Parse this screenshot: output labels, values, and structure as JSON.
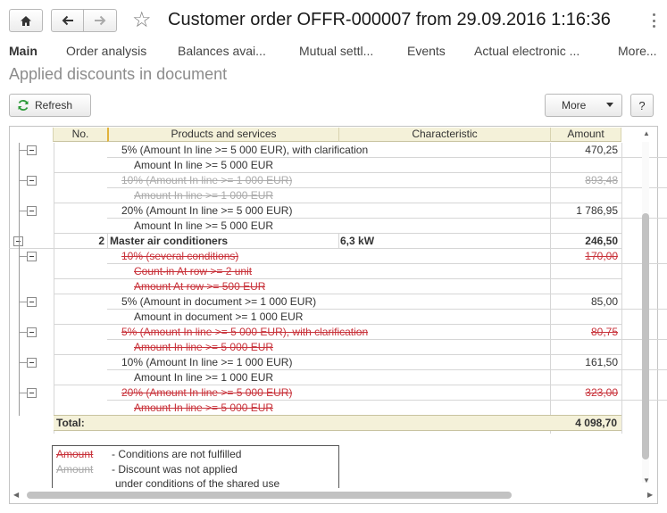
{
  "window": {
    "title": "Customer order OFFR-000007 from 29.09.2016 1:16:36",
    "home_icon": "home-icon",
    "back_icon": "arrow-left-icon",
    "forward_icon": "arrow-right-icon",
    "favorite_icon": "star-icon",
    "menu_icon": "kebab-icon"
  },
  "tabs": [
    "Main",
    "Order analysis",
    "Balances avai...",
    "Mutual settl...",
    "Events",
    "Actual electronic ...",
    "More..."
  ],
  "section_title": "Applied discounts in document",
  "toolbar": {
    "refresh_label": "Refresh",
    "more_label": "More",
    "help_label": "?"
  },
  "table": {
    "columns": [
      "No.",
      "Products and services",
      "Characteristic",
      "Amount"
    ],
    "rows": [
      {
        "text": "5% (Amount In line >= 5 000 EUR), with clarification",
        "amount": "470,25",
        "style": "normal",
        "toggle": true
      },
      {
        "text": "Amount In line >= 5 000 EUR",
        "amount": "",
        "style": "normal",
        "toggle": false
      },
      {
        "text": "10% (Amount In line >= 1 000 EUR)",
        "amount": "893,48",
        "style": "gray",
        "toggle": true
      },
      {
        "text": "Amount In line >= 1 000 EUR",
        "amount": "",
        "style": "gray",
        "toggle": false
      },
      {
        "text": "20% (Amount In line >= 5 000 EUR)",
        "amount": "1 786,95",
        "style": "normal",
        "toggle": true
      },
      {
        "text": "Amount In line >= 5 000 EUR",
        "amount": "",
        "style": "normal",
        "toggle": false
      },
      {
        "no": "2",
        "text": "Master air conditioners",
        "characteristic": "6,3 kW",
        "amount": "246,50",
        "style": "bold",
        "toggle": true
      },
      {
        "text": "10% (several conditions)",
        "amount": "170,00",
        "style": "red",
        "toggle": true
      },
      {
        "text": "Count-in At row >= 2 unit",
        "amount": "",
        "style": "red",
        "toggle": false
      },
      {
        "text": "Amount At row >= 500 EUR",
        "amount": "",
        "style": "red",
        "toggle": false
      },
      {
        "text": "5% (Amount in document >= 1 000 EUR)",
        "amount": "85,00",
        "style": "normal",
        "toggle": true
      },
      {
        "text": "Amount in document >= 1 000 EUR",
        "amount": "",
        "style": "normal",
        "toggle": false
      },
      {
        "text": "5% (Amount In line >= 5 000 EUR), with clarification",
        "amount": "80,75",
        "style": "red",
        "toggle": true
      },
      {
        "text": "Amount In line >= 5 000 EUR",
        "amount": "",
        "style": "red",
        "toggle": false
      },
      {
        "text": "10% (Amount In line >= 1 000 EUR)",
        "amount": "161,50",
        "style": "normal",
        "toggle": true
      },
      {
        "text": "Amount In line >= 1 000 EUR",
        "amount": "",
        "style": "normal",
        "toggle": false
      },
      {
        "text": "20% (Amount In line >= 5 000 EUR)",
        "amount": "323,00",
        "style": "red",
        "toggle": true
      },
      {
        "text": "Amount In line >= 5 000 EUR",
        "amount": "",
        "style": "red",
        "toggle": false
      }
    ],
    "total_label": "Total:",
    "total_amount": "4 098,70"
  },
  "legend": {
    "red_sample": "Amount",
    "red_text": "- Conditions are not fulfilled",
    "gray_sample": "Amount",
    "gray_text": "- Discount was not applied",
    "gray_text_2": "under conditions of the shared use"
  },
  "colors": {
    "not_fulfilled": "#c8323a",
    "not_applied": "#aaaaaa",
    "header_bg": "#f4f1d9"
  }
}
